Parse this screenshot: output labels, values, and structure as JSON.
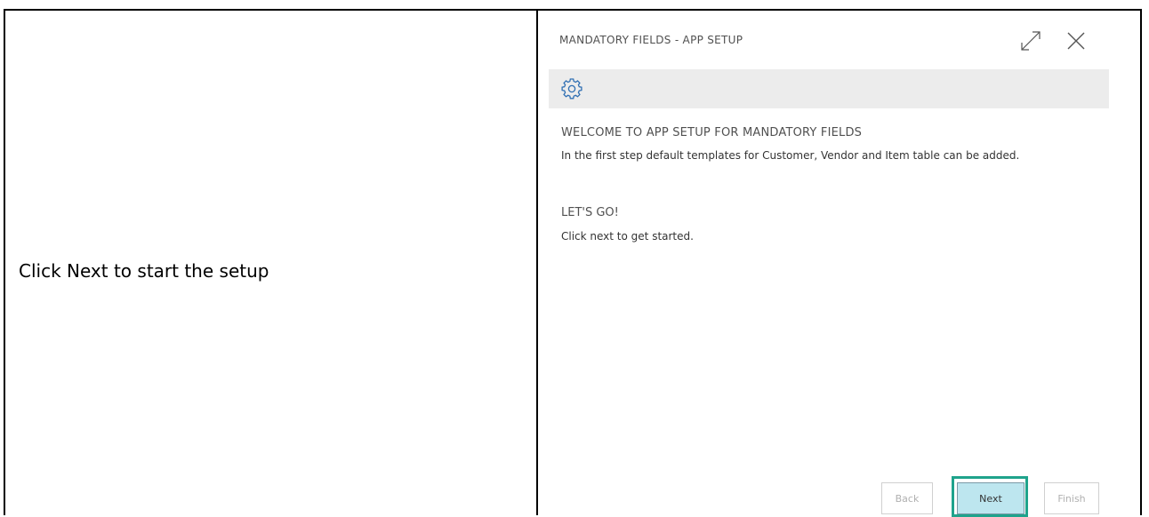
{
  "instruction": "Click Next to start the setup",
  "dialog": {
    "title": "MANDATORY FIELDS - APP SETUP",
    "icons": {
      "expand": "expand-icon",
      "close": "close-icon",
      "banner": "gear-icon"
    },
    "welcome_heading": "WELCOME TO APP SETUP FOR MANDATORY FIELDS",
    "welcome_text": "In the first step default templates for Customer, Vendor and Item table can be added.",
    "letsgo_heading": "LET'S GO!",
    "letsgo_text": "Click next to get started.",
    "buttons": {
      "back": "Back",
      "next": "Next",
      "finish": "Finish"
    }
  },
  "colors": {
    "highlight": "#1fa38c",
    "next_button_bg": "#bde6ef",
    "banner_bg": "#ececec",
    "gear_icon": "#2f6fb3"
  }
}
